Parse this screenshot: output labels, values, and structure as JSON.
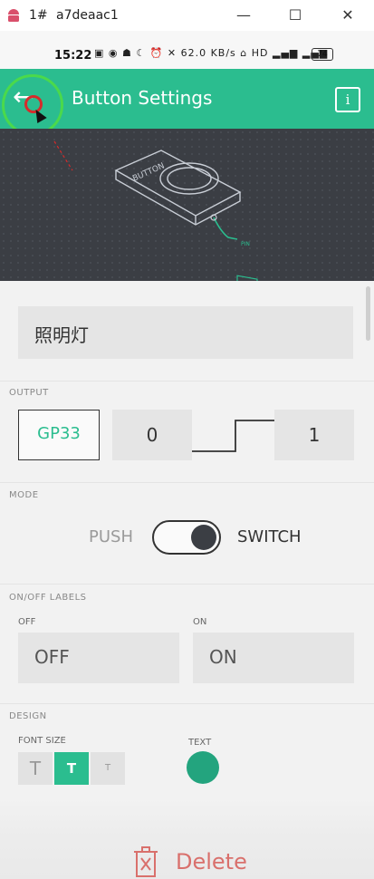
{
  "window": {
    "tab_label": "1#",
    "device_id": "a7deaac1",
    "minimize_label": "—",
    "maximize_label": "☐",
    "close_label": "✕"
  },
  "status_bar": {
    "time": "15:22",
    "icons_text": "▣ ◉ ☗ ☾ ⏰ ✕ 62.0 KB/s ⌂ HD ▂▄▆ ▂▄▆",
    "battery": "74"
  },
  "header": {
    "title": "Button Settings",
    "info_icon": "i",
    "bg_color": "#2bbd8f"
  },
  "hero": {
    "device_label": "BUTTON",
    "pin_label": "PIN"
  },
  "name_field": {
    "value": "照明灯"
  },
  "output": {
    "section_label": "OUTPUT",
    "pin": "GP33",
    "low_value": "0",
    "high_value": "1"
  },
  "mode": {
    "section_label": "MODE",
    "push_label": "PUSH",
    "switch_label": "SWITCH",
    "selected": "SWITCH"
  },
  "labels": {
    "section_label": "ON/OFF LABELS",
    "off_caption": "OFF",
    "on_caption": "ON",
    "off_value": "OFF",
    "on_value": "ON"
  },
  "design": {
    "section_label": "DESIGN",
    "font_size_label": "FONT SIZE",
    "text_label": "TEXT",
    "sizes": [
      "T",
      "T",
      "T"
    ],
    "text_color": "#23a47e"
  },
  "footer": {
    "delete_label": "Delete",
    "delete_color": "#d9706c"
  }
}
